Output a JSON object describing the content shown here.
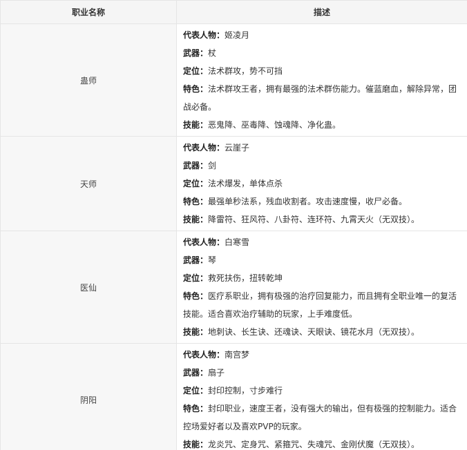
{
  "header": {
    "col1": "职业名称",
    "col2": "描述"
  },
  "rows": [
    {
      "name": "蛊师",
      "fields": [
        {
          "key": "代表人物：",
          "value": "姬凌月"
        },
        {
          "key": "武器：",
          "value": "杖"
        },
        {
          "key": "定位：",
          "value": "法术群攻，势不可挡"
        },
        {
          "key": "特色：",
          "value": "法术群攻王者，拥有最强的法术群伤能力。催蓝磨血，解除异常，团战必备。"
        },
        {
          "key": "技能：",
          "value": "恶鬼降、巫毒降、蚀魂降、净化蛊。"
        }
      ]
    },
    {
      "name": "天师",
      "fields": [
        {
          "key": "代表人物：",
          "value": "云崖子"
        },
        {
          "key": "武器：",
          "value": "剑"
        },
        {
          "key": "定位：",
          "value": "法术爆发，单体点杀"
        },
        {
          "key": "特色：",
          "value": "最强单秒法系，残血收割者。攻击速度慢，收尸必备。"
        },
        {
          "key": "技能：",
          "value": "降雷符、狂风符、八卦符、连环符、九霄天火（无双技）。"
        }
      ]
    },
    {
      "name": "医仙",
      "fields": [
        {
          "key": "代表人物：",
          "value": "白寒雪"
        },
        {
          "key": "武器：",
          "value": "琴"
        },
        {
          "key": "定位：",
          "value": "救死扶伤，扭转乾坤"
        },
        {
          "key": "特色：",
          "value": "医疗系职业，拥有极强的治疗回复能力，而且拥有全职业唯一的复活技能。适合喜欢治疗辅助的玩家，上手难度低。"
        },
        {
          "key": "技能：",
          "value": "地刺诀、长生诀、还魂诀、天眼诀、镜花水月（无双技）。"
        }
      ]
    },
    {
      "name": "阴阳",
      "fields": [
        {
          "key": "代表人物：",
          "value": "南宫梦"
        },
        {
          "key": "武器：",
          "value": "扇子"
        },
        {
          "key": "定位：",
          "value": "封印控制，寸步难行"
        },
        {
          "key": "特色：",
          "value": "封印职业，速度王者，没有强大的输出，但有极强的控制能力。适合控场爱好者以及喜欢PVP的玩家。"
        },
        {
          "key": "技能：",
          "value": "龙炎咒、定身咒、紧箍咒、失魂咒、金刚伏魔（无双技）。"
        }
      ]
    }
  ]
}
